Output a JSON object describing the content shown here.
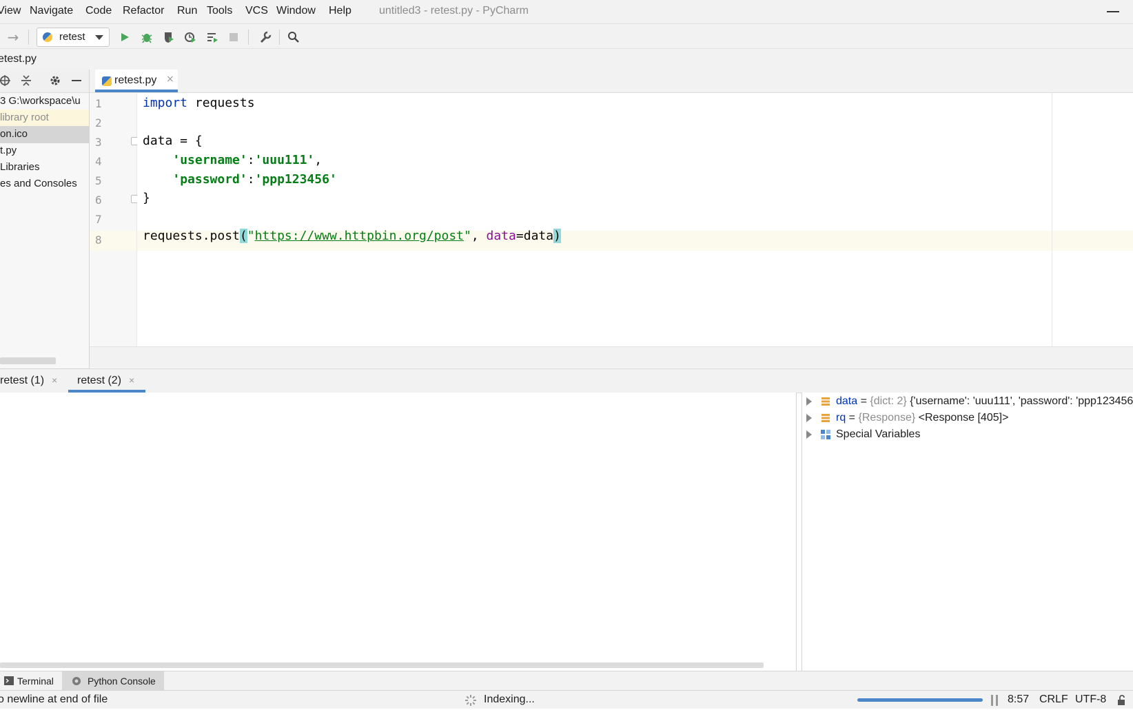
{
  "menu": {
    "items": [
      "View",
      "Navigate",
      "Code",
      "Refactor",
      "Run",
      "Tools",
      "VCS",
      "Window",
      "Help"
    ],
    "window_title": "untitled3 - retest.py - PyCharm"
  },
  "toolbar": {
    "run_config": "retest",
    "icons": [
      "forward-arrow-icon",
      "run-icon",
      "debug-icon",
      "coverage-icon",
      "profile-icon",
      "concurrency-icon",
      "stop-icon",
      "wrench-icon",
      "search-icon"
    ]
  },
  "breadcrumb": {
    "file": "etest.py"
  },
  "project": {
    "tree": [
      {
        "label": "3  G:\\workspace\\u"
      },
      {
        "label": " library root"
      },
      {
        "label": "on.ico"
      },
      {
        "label": "t.py"
      },
      {
        "label": " Libraries"
      },
      {
        "label": "es and Consoles"
      }
    ]
  },
  "editor": {
    "tab_label": "retest.py",
    "close_glyph": "×",
    "line_numbers": [
      "1",
      "2",
      "3",
      "4",
      "5",
      "6",
      "7",
      "8"
    ],
    "lines": {
      "l1_kw": "import",
      "l1_rest": " requests",
      "l3": "data = {",
      "l4_indent": "    ",
      "l4_key": "'username'",
      "l4_colon": ":",
      "l4_val": "'uuu111'",
      "l4_comma": ",",
      "l5_indent": "    ",
      "l5_key": "'password'",
      "l5_colon": ":",
      "l5_val": "'ppp123456'",
      "l6": "}",
      "l8_pre": "requests.post",
      "l8_open": "(",
      "l8_q1": "\"",
      "l8_url": "https://www.httpbin.org/post",
      "l8_q2": "\"",
      "l8_mid": ", ",
      "l8_param": "data",
      "l8_eq": "=data",
      "l8_close": ")"
    }
  },
  "run_tabs": [
    {
      "label": "retest (1)"
    },
    {
      "label": "retest (2)"
    }
  ],
  "variables": [
    {
      "name": "data",
      "eq": " = ",
      "type": "{dict: 2}",
      "value": " {'username': 'uuu111', 'password': 'ppp123456'}"
    },
    {
      "name": "rq",
      "eq": " = ",
      "type": "{Response}",
      "value": " <Response [405]>"
    },
    {
      "name": "Special Variables"
    }
  ],
  "tool_tabs": [
    "Terminal",
    "Python Console"
  ],
  "status": {
    "message": "o newline at end of file",
    "indexing": "Indexing...",
    "position": "8:57",
    "line_sep": "CRLF",
    "encoding": "UTF-8"
  },
  "colors": {
    "keyword": "#0033b3",
    "string": "#067d17",
    "param": "#871094",
    "accent": "#4a86c8"
  }
}
